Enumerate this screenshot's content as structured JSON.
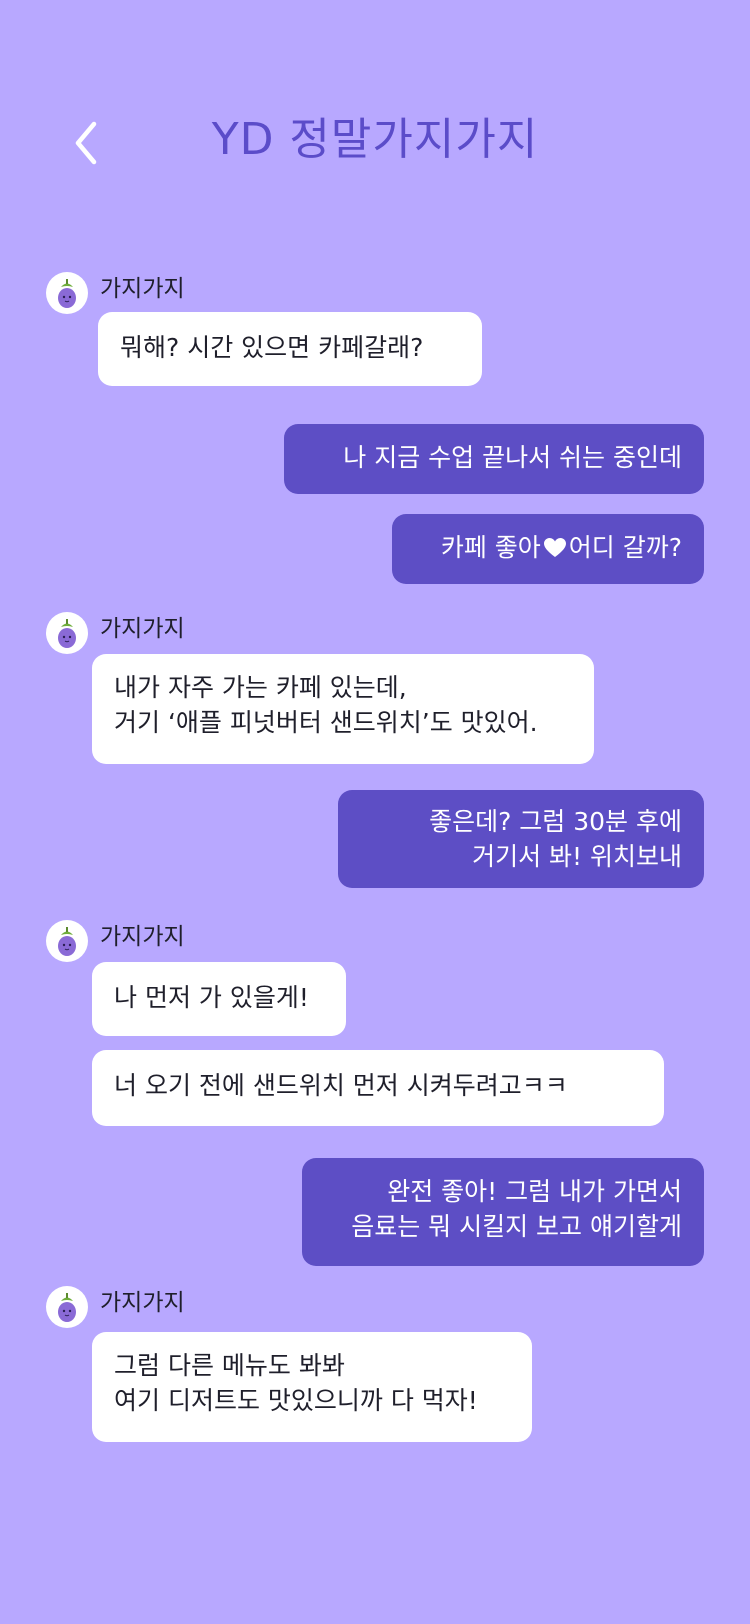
{
  "header": {
    "title": "YD 정말가지가지",
    "back_icon": "chevron-left-icon"
  },
  "theme": {
    "background": "#b8a8ff",
    "accent": "#5d4ec5",
    "title_color": "#5b4cc9",
    "incoming_bubble": "#ffffff",
    "outgoing_text": "#ffffff"
  },
  "contact": {
    "name": "가지가지",
    "avatar_icon": "eggplant-character-icon"
  },
  "messages": [
    {
      "sender": "가지가지",
      "direction": "incoming",
      "lines": [
        "뭐해? 시간 있으면 카페갈래?"
      ]
    },
    {
      "direction": "outgoing",
      "lines": [
        "나 지금 수업 끝나서 쉬는 중인데"
      ]
    },
    {
      "direction": "outgoing",
      "lines": [
        "카페 좋아",
        "어디 갈까?"
      ],
      "inline_icon": "heart-icon"
    },
    {
      "sender": "가지가지",
      "direction": "incoming",
      "lines": [
        "내가 자주 가는 카페 있는데,",
        "거기 ‘애플 피넛버터 샌드위치’도 맛있어."
      ]
    },
    {
      "direction": "outgoing",
      "lines": [
        "좋은데? 그럼 30분 후에",
        "거기서 봐! 위치보내"
      ]
    },
    {
      "sender": "가지가지",
      "direction": "incoming",
      "lines": [
        "나 먼저 가 있을게!"
      ]
    },
    {
      "direction": "incoming",
      "lines": [
        "너 오기 전에 샌드위치 먼저 시켜두려고ㅋㅋ"
      ]
    },
    {
      "direction": "outgoing",
      "lines": [
        "완전 좋아! 그럼 내가 가면서",
        "음료는 뭐 시킬지 보고 얘기할게"
      ]
    },
    {
      "sender": "가지가지",
      "direction": "incoming",
      "lines": [
        "그럼 다른 메뉴도 봐봐",
        "여기 디저트도 맛있으니까 다 먹자!"
      ]
    }
  ]
}
